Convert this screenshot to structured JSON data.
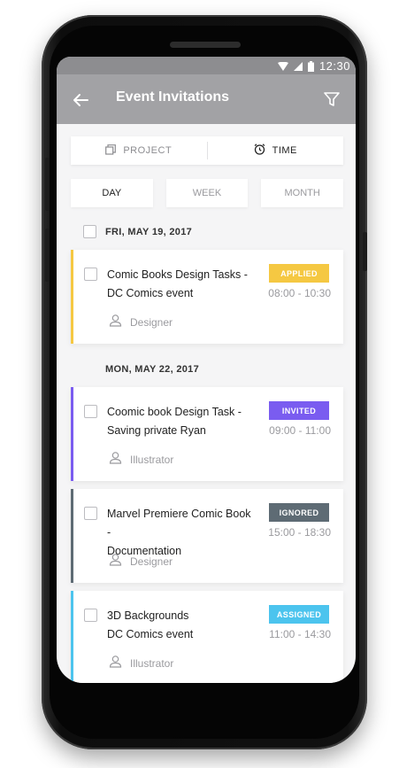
{
  "status_bar": {
    "time": "12:30",
    "icons": [
      "wifi-icon",
      "signal-icon",
      "battery-icon"
    ]
  },
  "app_bar": {
    "title": "Event Invitations",
    "back_icon": "arrow-left-icon",
    "filter_icon": "filter-icon"
  },
  "segment": {
    "items": [
      {
        "label": "PROJECT",
        "icon": "copy-icon",
        "active": false
      },
      {
        "label": "TIME",
        "icon": "alarm-clock-icon",
        "active": true
      }
    ]
  },
  "range_tabs": {
    "items": [
      {
        "label": "DAY",
        "active": true
      },
      {
        "label": "WEEK",
        "active": false
      },
      {
        "label": "MONTH",
        "active": false
      }
    ]
  },
  "groups": [
    {
      "date": "FRI, MAY 19, 2017",
      "events": [
        {
          "title_line1": "Comic Books Design Tasks -",
          "title_line2": "DC Comics event",
          "status": "APPLIED",
          "time": "08:00 - 10:30",
          "role": "Designer",
          "accent_color": "#f5c842"
        }
      ]
    },
    {
      "date": "MON, MAY 22, 2017",
      "events": [
        {
          "title_line1": "Coomic book Design Task -",
          "title_line2": "Saving private Ryan",
          "status": "INVITED",
          "time": "09:00 - 11:00",
          "role": "Illustrator",
          "accent_color": "#7a5cf0"
        },
        {
          "title_line1": "Marvel Premiere Comic Book -",
          "title_line2": "Documentation",
          "status": "IGNORED",
          "time": "15:00 - 18:30",
          "role": "Designer",
          "accent_color": "#5e6b74"
        },
        {
          "title_line1": "3D Backgrounds",
          "title_line2": "DC Comics event",
          "status": "ASSIGNED",
          "time": "11:00 - 14:30",
          "role": "Illustrator",
          "accent_color": "#4cc4ee"
        }
      ]
    }
  ],
  "colors": {
    "status_bar_bg": "#8d8d90",
    "app_bar_bg": "#a2a2a5",
    "applied": "#f5c842",
    "invited": "#7a5cf0",
    "ignored": "#5e6b74",
    "assigned": "#4cc4ee"
  }
}
